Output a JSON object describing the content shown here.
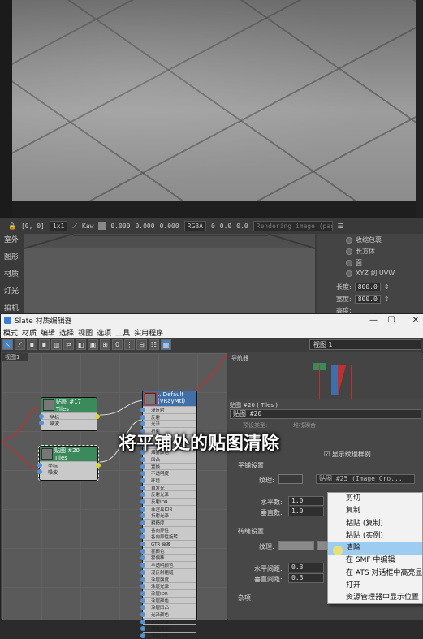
{
  "statusbar": {
    "coord": "[0, 0]",
    "ratio": "1x1",
    "kaw": "Kaw",
    "v1": "0.000",
    "v2": "0.000",
    "v3": "0.000",
    "colorspace": "RGBA",
    "n1": "0",
    "n2": "0.0",
    "n3": "0.0",
    "rendering": "Rendering image (pass"
  },
  "max_left_tabs": [
    "室外",
    "图形",
    "材质",
    "灯光",
    "拍机"
  ],
  "max_right_panel": {
    "options": [
      "收缩包裹",
      "长方体",
      "面",
      "XYZ 到 UVW"
    ],
    "length_label": "长度:",
    "length_value": "800.0",
    "width_label": "宽度:",
    "width_value": "800.0",
    "height_label": "高度:"
  },
  "slate": {
    "title": "Slate 材质编辑器",
    "menu": [
      "模式",
      "材质",
      "编辑",
      "选择",
      "视图",
      "选项",
      "工具",
      "实用程序"
    ],
    "view_select": "视图 1",
    "canvas_tab": "视图1",
    "nav_label": "导航器",
    "node1": {
      "title": "贴图 #17",
      "subtitle": "Tiles",
      "rows": [
        "坐标",
        "噪波"
      ]
    },
    "node2": {
      "title": "贴图 #20",
      "subtitle": "Tiles",
      "rows": [
        "坐标",
        "噪波"
      ]
    },
    "big_node": {
      "title": "...Default",
      "subtitle": "(VRayMtl)",
      "rows": [
        "漫反射",
        "反射",
        "光泽",
        "折射",
        "IOR",
        "半透明",
        "烟雾颜色",
        "凹凸",
        "置换",
        "不透明度",
        "环境",
        "自发光",
        "反射光泽",
        "反射IOR",
        "菲涅耳IOR",
        "折射光泽",
        "粗糙度",
        "各向异性",
        "各向异性旋转",
        "GTR 衰减",
        "雾颜色",
        "雾偏移",
        "半透明颜色",
        "漫反射粗糙",
        "涂层强度",
        "涂层光泽",
        "涂层IOR",
        "涂层颜色",
        "涂层凹凸",
        "光泽颜色",
        "光泽光泽",
        "薄膜厚度",
        "薄膜IOR"
      ]
    },
    "props": {
      "header": "贴图 #20 ( Tiles )",
      "name": "贴图 #20",
      "preset_label": "预设类型:",
      "preset_value": "堆栈砌合",
      "show_texture": "显示纹理样例",
      "tile_setup": "平铺设置",
      "texture_label": "纹理:",
      "texture_map": "贴图 #25 (Image Cro...",
      "h_count_label": "水平数:",
      "h_count": "1.0",
      "v_count_label": "垂直数:",
      "v_count": "1.0",
      "grout_setup": "砖缝设置",
      "grout_texture_label": "纹理:",
      "h_gap_label": "水平间距:",
      "h_gap": "0.3",
      "v_gap_label": "垂直间距:",
      "v_gap": "0.3",
      "misc": "杂项"
    }
  },
  "context_menu": [
    "剪切",
    "复制",
    "粘贴 (复制)",
    "粘贴 (实例)",
    "清除",
    "在 SMF 中编辑",
    "在 ATS 对话框中高亮显示",
    "打开",
    "资源管理器中显示位置"
  ],
  "caption": "将平铺处的贴图清除",
  "colors": {
    "node_green": "#3a8a5c",
    "node_blue": "#3f6fa6",
    "highlight": "#9ecbf0",
    "wire_red": "#c03030"
  }
}
